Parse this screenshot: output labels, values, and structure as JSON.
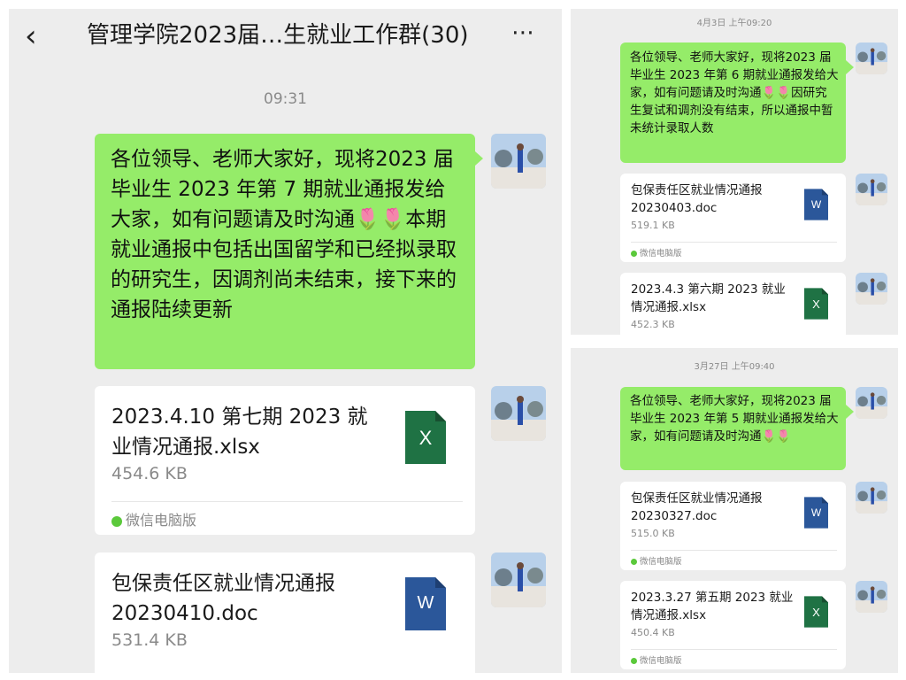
{
  "left": {
    "title": "管理学院2023届…生就业工作群(30)",
    "time": "09:31",
    "message": "各位领导、老师大家好，现将2023 届毕业生 2023 年第 7 期就业通报发给大家，如有问题请及时沟通🌷🌷本期就业通报中包括出国留学和已经拟录取的研究生，因调剂尚未结束，接下来的通报陆续更新",
    "files": [
      {
        "name": "2023.4.10 第七期 2023 就业情况通报.xlsx",
        "size": "454.6 KB",
        "type": "X",
        "source": "微信电脑版"
      },
      {
        "name": "包保责任区就业情况通报20230410.doc",
        "size": "531.4 KB",
        "type": "W"
      }
    ]
  },
  "right_top": {
    "time": "4月3日 上午09:20",
    "message": "各位领导、老师大家好，现将2023 届毕业生 2023 年第 6 期就业通报发给大家，如有问题请及时沟通🌷🌷因研究生复试和调剂没有结束，所以通报中暂未统计录取人数",
    "files": [
      {
        "name": "包保责任区就业情况通报20230403.doc",
        "size": "519.1 KB",
        "type": "W",
        "source": "微信电脑版"
      },
      {
        "name": "2023.4.3 第六期 2023 就业情况通报.xlsx",
        "size": "452.3 KB",
        "type": "X"
      }
    ]
  },
  "right_bottom": {
    "time": "3月27日 上午09:40",
    "message": "各位领导、老师大家好，现将2023 届毕业生 2023 年第 5 期就业通报发给大家，如有问题请及时沟通🌷🌷",
    "files": [
      {
        "name": "包保责任区就业情况通报20230327.doc",
        "size": "515.0 KB",
        "type": "W",
        "source": "微信电脑版"
      },
      {
        "name": "2023.3.27 第五期 2023 就业情况通报.xlsx",
        "size": "450.4 KB",
        "type": "X",
        "source": "微信电脑版"
      }
    ]
  },
  "colors": {
    "bubble": "#95ec69",
    "excel": "#1f7244",
    "word": "#2b579a",
    "background": "#ededed"
  },
  "icons": {
    "back": "chevron-left-icon",
    "more": "more-dots-icon",
    "excel": "excel-file-icon",
    "word": "word-file-icon",
    "source": "wechat-pc-icon"
  }
}
